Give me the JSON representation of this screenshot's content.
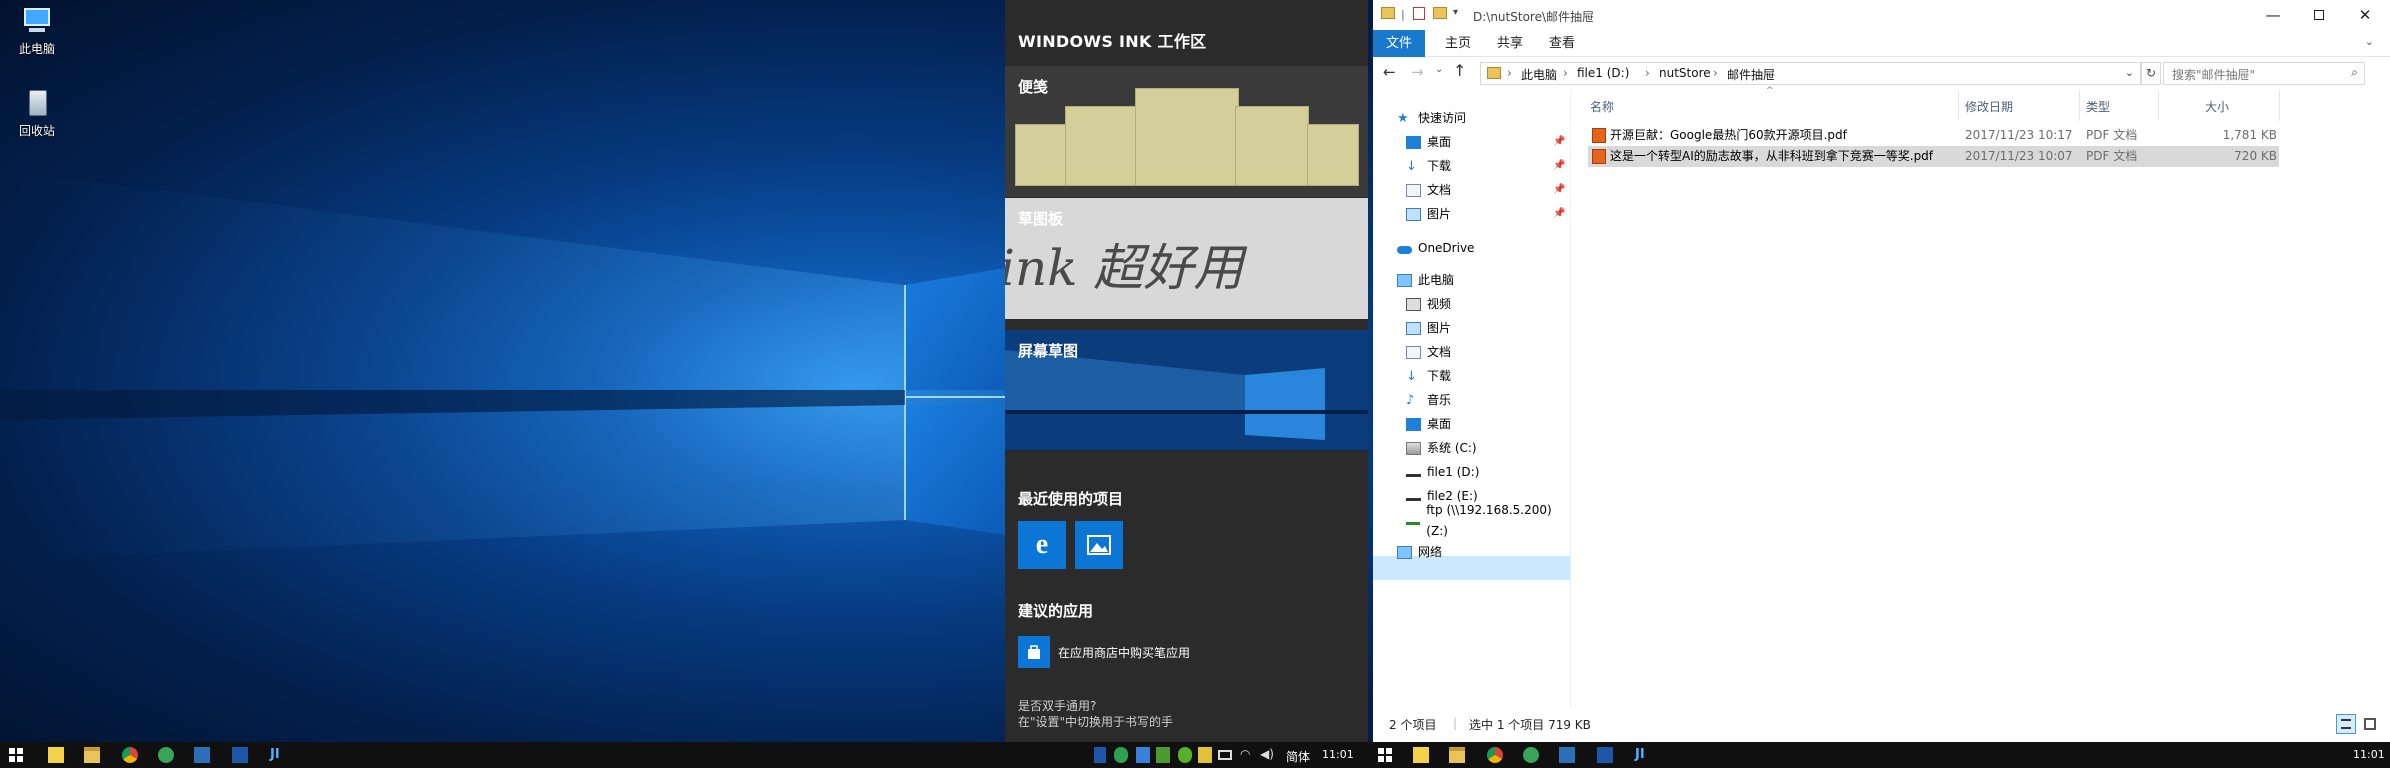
{
  "desktop": {
    "icons": [
      {
        "label": "此电脑",
        "icon": "computer-icon"
      },
      {
        "label": "回收站",
        "icon": "recycle-bin-icon"
      }
    ]
  },
  "ink_workspace": {
    "title": "WINDOWS INK 工作区",
    "sticky_notes_label": "便笺",
    "sketchpad_label": "草图板",
    "sketchpad_handwriting": "ink 超好用",
    "screen_sketch_label": "屏幕草图",
    "recent_label": "最近使用的项目",
    "recent_apps": [
      "edge-icon",
      "photos-icon"
    ],
    "suggested_label": "建议的应用",
    "store_link": "在应用商店中购买笔应用",
    "footer_line1": "是否双手通用?",
    "footer_line2": "在\"设置\"中切换用于书写的手",
    "accent": "#0c76d6"
  },
  "explorer": {
    "title_path": "D:\\nutStore\\邮件抽屉",
    "ribbon_tabs": [
      "文件",
      "主页",
      "共享",
      "查看"
    ],
    "breadcrumbs": [
      "此电脑",
      "file1 (D:)",
      "nutStore",
      "邮件抽屉"
    ],
    "search_placeholder": "搜索\"邮件抽屉\"",
    "nav": {
      "quick_access": "快速访问",
      "quick_items": [
        "桌面",
        "下载",
        "文档",
        "图片"
      ],
      "onedrive": "OneDrive",
      "this_pc": "此电脑",
      "pc_items": [
        "视频",
        "图片",
        "文档",
        "下载",
        "音乐",
        "桌面",
        "系统 (C:)",
        "file1 (D:)",
        "file2 (E:)",
        "ftp (\\\\192.168.5.200) (Z:)"
      ],
      "network": "网络",
      "selected": "file1 (D:)"
    },
    "columns": [
      "名称",
      "修改日期",
      "类型",
      "大小"
    ],
    "files": [
      {
        "name": "开源巨献：Google最热门60款开源项目.pdf",
        "date": "2017/11/23 10:17",
        "type": "PDF 文档",
        "size": "1,781 KB",
        "selected": false
      },
      {
        "name": "这是一个转型AI的励志故事，从非科班到拿下竞赛一等奖.pdf",
        "date": "2017/11/23 10:07",
        "type": "PDF 文档",
        "size": "720 KB",
        "selected": true
      }
    ],
    "status_count": "2 个项目",
    "status_selection": "选中 1 个项目  719 KB"
  },
  "taskbar": {
    "lang": "简体",
    "time_left": "11:01",
    "time_right": "11:01"
  }
}
